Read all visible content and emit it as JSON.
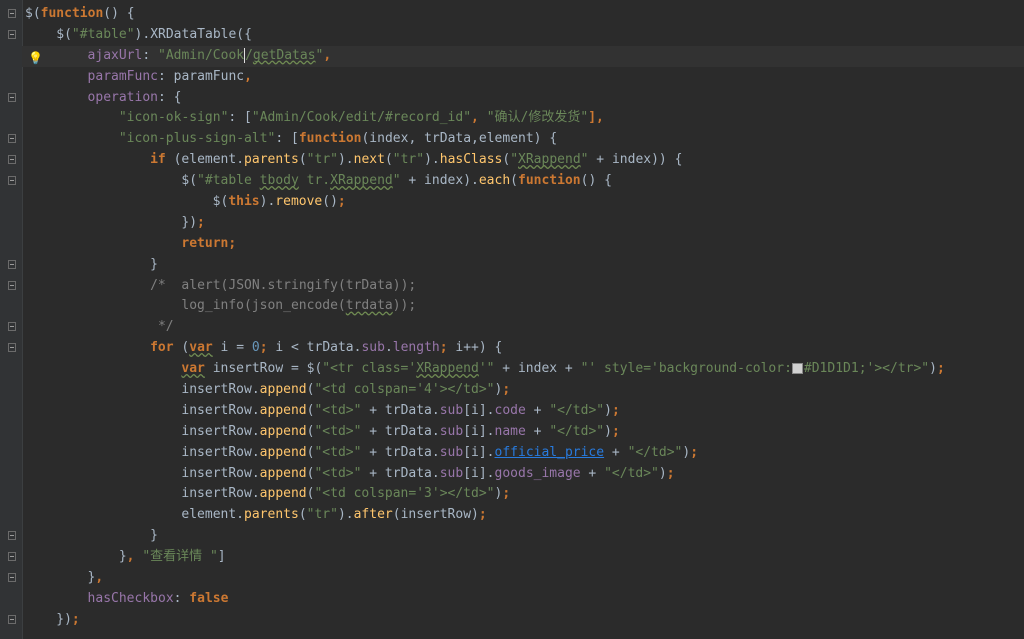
{
  "editor": {
    "lines": [
      {
        "indent": 0,
        "fold": true,
        "tokens": [
          {
            "t": "$",
            "c": "op"
          },
          {
            "t": "(",
            "c": "op"
          },
          {
            "t": "function",
            "c": "kw"
          },
          {
            "t": "() {",
            "c": "op"
          }
        ]
      },
      {
        "indent": 4,
        "fold": true,
        "tokens": [
          {
            "t": "$",
            "c": "op"
          },
          {
            "t": "(",
            "c": "op"
          },
          {
            "t": "\"#table\"",
            "c": "str"
          },
          {
            "t": ").XRDataTable({",
            "c": "op"
          }
        ]
      },
      {
        "indent": 8,
        "bulb": true,
        "current": true,
        "tokens": [
          {
            "t": "ajaxUrl",
            "c": "prop"
          },
          {
            "t": ": ",
            "c": "op"
          },
          {
            "t": "\"Admin/Cook",
            "c": "str"
          },
          {
            "caret": true
          },
          {
            "t": "/",
            "c": "str"
          },
          {
            "t": "getDatas",
            "c": "str u"
          },
          {
            "t": "\"",
            "c": "str"
          },
          {
            "t": ",",
            "c": "kw"
          }
        ]
      },
      {
        "indent": 8,
        "tokens": [
          {
            "t": "paramFunc",
            "c": "prop"
          },
          {
            "t": ": ",
            "c": "op"
          },
          {
            "t": "paramFunc",
            "c": "op"
          },
          {
            "t": ",",
            "c": "kw"
          }
        ]
      },
      {
        "indent": 8,
        "fold": true,
        "tokens": [
          {
            "t": "operation",
            "c": "prop"
          },
          {
            "t": ": {",
            "c": "op"
          }
        ]
      },
      {
        "indent": 12,
        "tokens": [
          {
            "t": "\"icon-ok-sign\"",
            "c": "str"
          },
          {
            "t": ": [",
            "c": "op"
          },
          {
            "t": "\"Admin/Cook/edit/#record_id\"",
            "c": "str"
          },
          {
            "t": ", ",
            "c": "kw"
          },
          {
            "t": "\"确认/修改发货\"",
            "c": "str"
          },
          {
            "t": "],",
            "c": "kw"
          }
        ]
      },
      {
        "indent": 12,
        "fold": true,
        "tokens": [
          {
            "t": "\"icon-plus-sign-alt\"",
            "c": "str"
          },
          {
            "t": ": [",
            "c": "op"
          },
          {
            "t": "function",
            "c": "kw"
          },
          {
            "t": "(index, trData,element) {",
            "c": "op"
          }
        ]
      },
      {
        "indent": 16,
        "fold": true,
        "tokens": [
          {
            "t": "if",
            "c": "kw"
          },
          {
            "t": " (element.",
            "c": "op"
          },
          {
            "t": "parents",
            "c": "fn"
          },
          {
            "t": "(",
            "c": "op"
          },
          {
            "t": "\"tr\"",
            "c": "str"
          },
          {
            "t": ").",
            "c": "op"
          },
          {
            "t": "next",
            "c": "fn"
          },
          {
            "t": "(",
            "c": "op"
          },
          {
            "t": "\"tr\"",
            "c": "str"
          },
          {
            "t": ").",
            "c": "op"
          },
          {
            "t": "hasClass",
            "c": "fn"
          },
          {
            "t": "(",
            "c": "op"
          },
          {
            "t": "\"",
            "c": "str"
          },
          {
            "t": "XRappend",
            "c": "str u"
          },
          {
            "t": "\"",
            "c": "str"
          },
          {
            "t": " + index)) {",
            "c": "op"
          }
        ]
      },
      {
        "indent": 20,
        "fold": true,
        "tokens": [
          {
            "t": "$",
            "c": "op"
          },
          {
            "t": "(",
            "c": "op"
          },
          {
            "t": "\"#table ",
            "c": "str"
          },
          {
            "t": "tbody",
            "c": "str u"
          },
          {
            "t": " tr.",
            "c": "str"
          },
          {
            "t": "XRappend",
            "c": "str u"
          },
          {
            "t": "\"",
            "c": "str"
          },
          {
            "t": " + index).",
            "c": "op"
          },
          {
            "t": "each",
            "c": "fn"
          },
          {
            "t": "(",
            "c": "op"
          },
          {
            "t": "function",
            "c": "kw"
          },
          {
            "t": "() {",
            "c": "op"
          }
        ]
      },
      {
        "indent": 24,
        "tokens": [
          {
            "t": "$",
            "c": "op"
          },
          {
            "t": "(",
            "c": "op"
          },
          {
            "t": "this",
            "c": "kw"
          },
          {
            "t": ").",
            "c": "op"
          },
          {
            "t": "remove",
            "c": "fn"
          },
          {
            "t": "()",
            "c": "op"
          },
          {
            "t": ";",
            "c": "kw"
          }
        ]
      },
      {
        "indent": 20,
        "tokens": [
          {
            "t": "})",
            "c": "op"
          },
          {
            "t": ";",
            "c": "kw"
          }
        ]
      },
      {
        "indent": 20,
        "tokens": [
          {
            "t": "return",
            "c": "kw"
          },
          {
            "t": ";",
            "c": "kw"
          }
        ]
      },
      {
        "indent": 16,
        "fold": true,
        "tokens": [
          {
            "t": "}",
            "c": "op"
          }
        ]
      },
      {
        "indent": 16,
        "fold": true,
        "tokens": [
          {
            "t": "/*  alert(JSON.stringify(trData));",
            "c": "cmt"
          }
        ]
      },
      {
        "indent": 20,
        "tokens": [
          {
            "t": "log_info(json_encode(",
            "c": "cmt"
          },
          {
            "t": "trdata",
            "c": "cmt u"
          },
          {
            "t": "));",
            "c": "cmt"
          }
        ]
      },
      {
        "indent": 17,
        "fold": true,
        "tokens": [
          {
            "t": "*/",
            "c": "cmt"
          }
        ]
      },
      {
        "indent": 16,
        "fold": true,
        "tokens": [
          {
            "t": "for",
            "c": "kw"
          },
          {
            "t": " (",
            "c": "op"
          },
          {
            "t": "var",
            "c": "kw u"
          },
          {
            "t": " i = ",
            "c": "op"
          },
          {
            "t": "0",
            "c": "num"
          },
          {
            "t": "; ",
            "c": "kw"
          },
          {
            "t": "i < trData.",
            "c": "op"
          },
          {
            "t": "sub",
            "c": "prop"
          },
          {
            "t": ".",
            "c": "op"
          },
          {
            "t": "length",
            "c": "prop"
          },
          {
            "t": "; ",
            "c": "kw"
          },
          {
            "t": "i++) {",
            "c": "op"
          }
        ]
      },
      {
        "indent": 20,
        "tokens": [
          {
            "t": "var",
            "c": "kw u"
          },
          {
            "t": " insertRow = ",
            "c": "op"
          },
          {
            "t": "$",
            "c": "op"
          },
          {
            "t": "(",
            "c": "op"
          },
          {
            "t": "\"<tr class='",
            "c": "str"
          },
          {
            "t": "XRappend",
            "c": "str u"
          },
          {
            "t": "'\"",
            "c": "str"
          },
          {
            "t": " + index + ",
            "c": "op"
          },
          {
            "t": "\"' style='background-color:",
            "c": "str"
          },
          {
            "swatch": "#D1D1D1"
          },
          {
            "t": "#D1D1D1;'></tr>\"",
            "c": "str"
          },
          {
            "t": ")",
            "c": "op"
          },
          {
            "t": ";",
            "c": "kw"
          }
        ]
      },
      {
        "indent": 20,
        "tokens": [
          {
            "t": "insertRow.",
            "c": "op"
          },
          {
            "t": "append",
            "c": "fn"
          },
          {
            "t": "(",
            "c": "op"
          },
          {
            "t": "\"<td colspan='4'></td>\"",
            "c": "str"
          },
          {
            "t": ")",
            "c": "op"
          },
          {
            "t": ";",
            "c": "kw"
          }
        ]
      },
      {
        "indent": 20,
        "tokens": [
          {
            "t": "insertRow.",
            "c": "op"
          },
          {
            "t": "append",
            "c": "fn"
          },
          {
            "t": "(",
            "c": "op"
          },
          {
            "t": "\"<td>\"",
            "c": "str"
          },
          {
            "t": " + trData.",
            "c": "op"
          },
          {
            "t": "sub",
            "c": "prop"
          },
          {
            "t": "[i].",
            "c": "op"
          },
          {
            "t": "code",
            "c": "prop"
          },
          {
            "t": " + ",
            "c": "op"
          },
          {
            "t": "\"</td>\"",
            "c": "str"
          },
          {
            "t": ")",
            "c": "op"
          },
          {
            "t": ";",
            "c": "kw"
          }
        ]
      },
      {
        "indent": 20,
        "tokens": [
          {
            "t": "insertRow.",
            "c": "op"
          },
          {
            "t": "append",
            "c": "fn"
          },
          {
            "t": "(",
            "c": "op"
          },
          {
            "t": "\"<td>\"",
            "c": "str"
          },
          {
            "t": " + trData.",
            "c": "op"
          },
          {
            "t": "sub",
            "c": "prop"
          },
          {
            "t": "[i].",
            "c": "op"
          },
          {
            "t": "name",
            "c": "prop"
          },
          {
            "t": " + ",
            "c": "op"
          },
          {
            "t": "\"</td>\"",
            "c": "str"
          },
          {
            "t": ")",
            "c": "op"
          },
          {
            "t": ";",
            "c": "kw"
          }
        ]
      },
      {
        "indent": 20,
        "tokens": [
          {
            "t": "insertRow.",
            "c": "op"
          },
          {
            "t": "append",
            "c": "fn"
          },
          {
            "t": "(",
            "c": "op"
          },
          {
            "t": "\"<td>\"",
            "c": "str"
          },
          {
            "t": " + trData.",
            "c": "op"
          },
          {
            "t": "sub",
            "c": "prop"
          },
          {
            "t": "[i].",
            "c": "op"
          },
          {
            "t": "official_price",
            "c": "link"
          },
          {
            "t": " + ",
            "c": "op"
          },
          {
            "t": "\"</td>\"",
            "c": "str"
          },
          {
            "t": ")",
            "c": "op"
          },
          {
            "t": ";",
            "c": "kw"
          }
        ]
      },
      {
        "indent": 20,
        "tokens": [
          {
            "t": "insertRow.",
            "c": "op"
          },
          {
            "t": "append",
            "c": "fn"
          },
          {
            "t": "(",
            "c": "op"
          },
          {
            "t": "\"<td>\"",
            "c": "str"
          },
          {
            "t": " + trData.",
            "c": "op"
          },
          {
            "t": "sub",
            "c": "prop"
          },
          {
            "t": "[i].",
            "c": "op"
          },
          {
            "t": "goods_image",
            "c": "prop"
          },
          {
            "t": " + ",
            "c": "op"
          },
          {
            "t": "\"</td>\"",
            "c": "str"
          },
          {
            "t": ")",
            "c": "op"
          },
          {
            "t": ";",
            "c": "kw"
          }
        ]
      },
      {
        "indent": 20,
        "tokens": [
          {
            "t": "insertRow.",
            "c": "op"
          },
          {
            "t": "append",
            "c": "fn"
          },
          {
            "t": "(",
            "c": "op"
          },
          {
            "t": "\"<td colspan='3'></td>\"",
            "c": "str"
          },
          {
            "t": ")",
            "c": "op"
          },
          {
            "t": ";",
            "c": "kw"
          }
        ]
      },
      {
        "indent": 20,
        "tokens": [
          {
            "t": "element.",
            "c": "op"
          },
          {
            "t": "parents",
            "c": "fn"
          },
          {
            "t": "(",
            "c": "op"
          },
          {
            "t": "\"tr\"",
            "c": "str"
          },
          {
            "t": ").",
            "c": "op"
          },
          {
            "t": "after",
            "c": "fn"
          },
          {
            "t": "(insertRow)",
            "c": "op"
          },
          {
            "t": ";",
            "c": "kw"
          }
        ]
      },
      {
        "indent": 16,
        "fold": true,
        "tokens": [
          {
            "t": "}",
            "c": "op"
          }
        ]
      },
      {
        "indent": 12,
        "fold": true,
        "tokens": [
          {
            "t": "}",
            "c": "op"
          },
          {
            "t": ", ",
            "c": "kw"
          },
          {
            "t": "\"查看详情 \"",
            "c": "str"
          },
          {
            "t": "]",
            "c": "op"
          }
        ]
      },
      {
        "indent": 8,
        "fold": true,
        "tokens": [
          {
            "t": "}",
            "c": "op"
          },
          {
            "t": ",",
            "c": "kw"
          }
        ]
      },
      {
        "indent": 8,
        "tokens": [
          {
            "t": "hasCheckbox",
            "c": "prop"
          },
          {
            "t": ": ",
            "c": "op"
          },
          {
            "t": "false",
            "c": "kw"
          }
        ]
      },
      {
        "indent": 4,
        "fold": true,
        "tokens": [
          {
            "t": "})",
            "c": "op"
          },
          {
            "t": ";",
            "c": "kw"
          }
        ]
      }
    ]
  }
}
